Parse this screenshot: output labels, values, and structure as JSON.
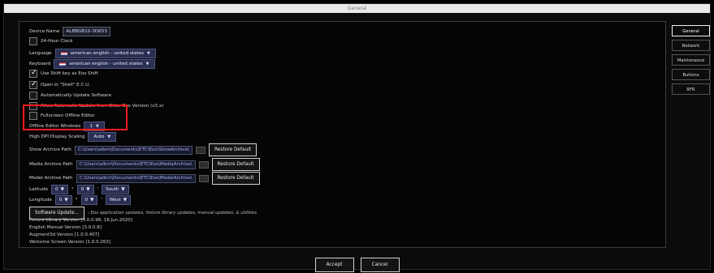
{
  "window": {
    "title": "General"
  },
  "general": {
    "device_name_label": "Device Name",
    "device_name_value": "ALBBGB10-3DK53",
    "clock_24h": {
      "label": "24-Hour Clock",
      "checked": false
    },
    "language": {
      "label": "Language",
      "value": "american english - united states"
    },
    "keyboard": {
      "label": "Keyboard",
      "value": "american english - united states"
    },
    "use_shift_key": {
      "label": "Use Shift key as Eos Shift",
      "checked": true
    },
    "open_shell": {
      "label": "Open in \"Shell\" E.C.U.",
      "checked": true
    },
    "auto_update": {
      "label": "Automatically Update Software",
      "checked": false
    },
    "allow_auto_update": {
      "label": "Allow Automatic Update from Older Eos Version (v3.x)",
      "checked": false
    },
    "fullscreen_offline": {
      "label": "Fullscreen Offline Editor",
      "checked": false
    },
    "offline_windows": {
      "label": "Offline Editor Windows",
      "value": "1"
    },
    "hidpi": {
      "label": "High DPI Display Scaling",
      "value": "Auto"
    },
    "show_archive": {
      "label": "Show Archive Path",
      "path": "C:\\Users\\albrn\\Documents\\ETC\\Eos\\ShowArchive\\",
      "restore": "Restore Default"
    },
    "media_archive": {
      "label": "Media Archive Path",
      "path": "C:\\Users\\albrn\\Documents\\ETC\\Eos\\MediaArchive\\",
      "restore": "Restore Default"
    },
    "model_archive": {
      "label": "Model Archive Path",
      "path": "C:\\Users\\albrn\\Documents\\ETC\\Eos\\ModelArchive\\",
      "restore": "Restore Default"
    },
    "latitude": {
      "label": "Latitude",
      "deg": "0",
      "min": "0",
      "dir": "South"
    },
    "longitude": {
      "label": "Longitude",
      "deg": "0",
      "min": "0",
      "dir": "West"
    },
    "software_update": {
      "label": "Software Update...",
      "note": "- Eos application updates, fixture library updates, manual updates, & utilities"
    },
    "versions": [
      "Fixture Library Version [3.0.0.98, 18.Jun.2020]",
      "English Manual Version [3.0.0.8]",
      "Augment3d Version [1.0.0.407]",
      "Welcome Screen Version [1.0.0.263]"
    ]
  },
  "sidebar": {
    "items": [
      "General",
      "Network",
      "Maintenance",
      "Buttons",
      "RFR"
    ]
  },
  "footer": {
    "accept": "Accept",
    "cancel": "Cancel"
  }
}
